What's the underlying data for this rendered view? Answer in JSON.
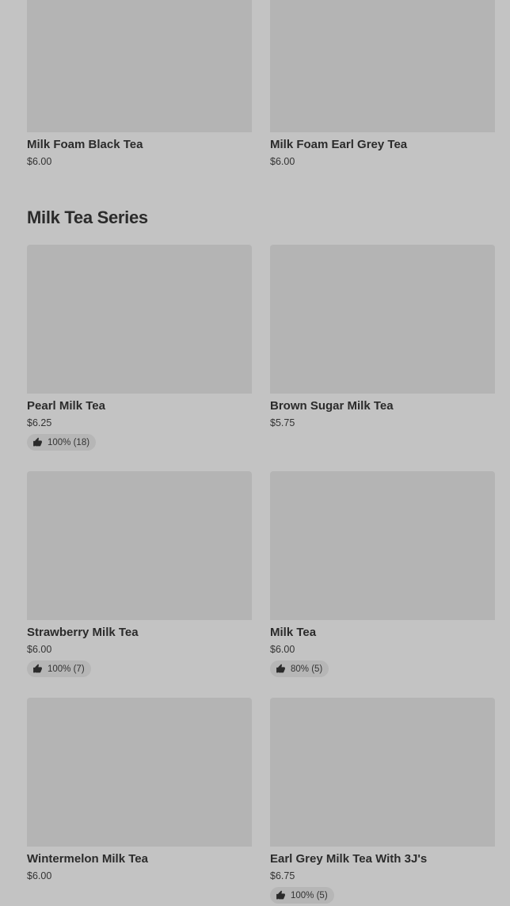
{
  "top_items": [
    {
      "name": "Milk Foam Black Tea",
      "price": "$6.00"
    },
    {
      "name": "Milk Foam Earl Grey Tea",
      "price": "$6.00"
    }
  ],
  "section": {
    "title": "Milk Tea Series",
    "items": [
      {
        "name": "Pearl Milk Tea",
        "price": "$6.25",
        "rating": "100% (18)"
      },
      {
        "name": "Brown Sugar Milk Tea",
        "price": "$5.75",
        "rating": ""
      },
      {
        "name": "Strawberry Milk Tea",
        "price": "$6.00",
        "rating": "100% (7)"
      },
      {
        "name": "Milk Tea",
        "price": "$6.00",
        "rating": "80% (5)"
      },
      {
        "name": "Wintermelon Milk Tea",
        "price": "$6.00",
        "rating": ""
      },
      {
        "name": "Earl Grey Milk Tea With 3J's",
        "price": "$6.75",
        "rating": "100% (5)"
      }
    ]
  },
  "icons": {
    "rating": "thumbs-up-icon"
  }
}
